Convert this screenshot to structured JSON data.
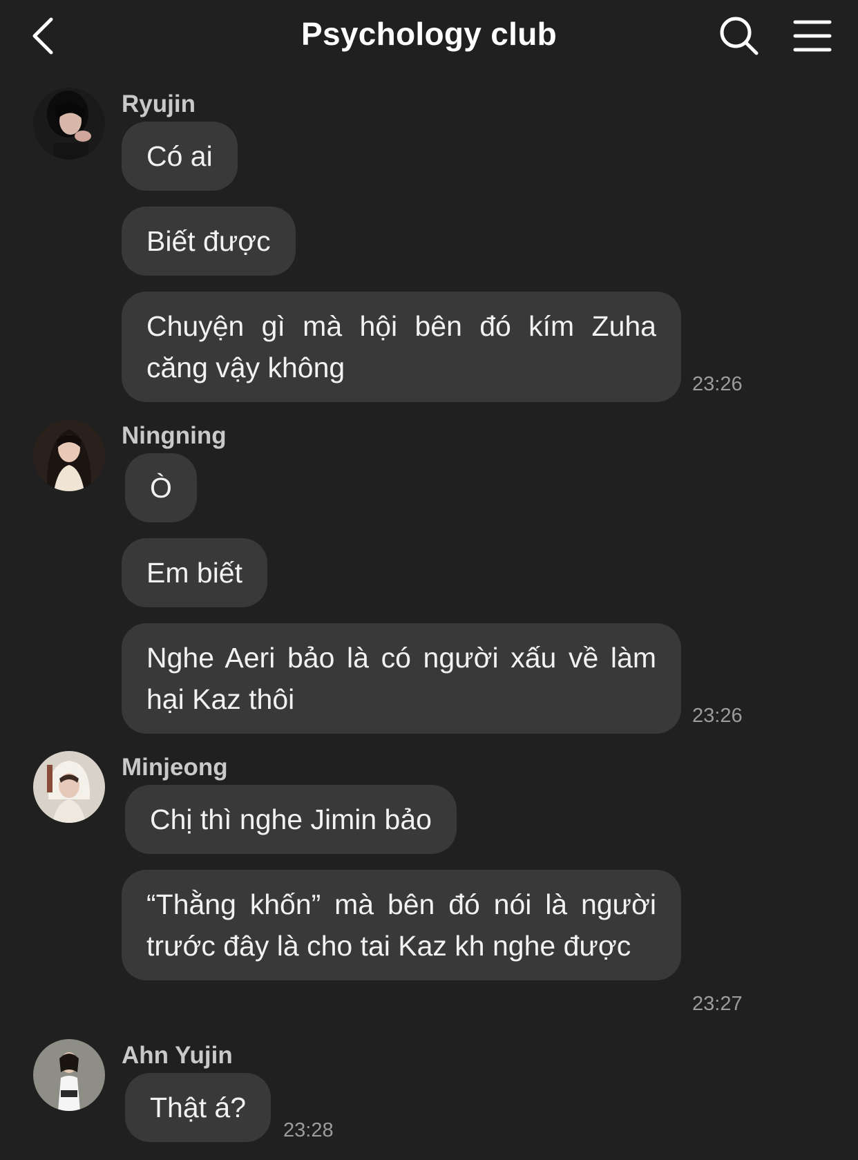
{
  "header": {
    "title": "Psychology club",
    "back_icon": "chevron-left-icon",
    "search_icon": "search-icon",
    "menu_icon": "hamburger-menu-icon"
  },
  "messages": [
    {
      "sender": "Ryujin",
      "bubbles": [
        "Có ai",
        "Biết được",
        "Chuyện gì mà hội bên đó kím Zuha căng vậy không"
      ],
      "time": "23:26"
    },
    {
      "sender": "Ningning",
      "bubbles": [
        "Ò",
        "Em biết",
        "Nghe Aeri bảo là có người xấu về làm hại Kaz thôi"
      ],
      "time": "23:26"
    },
    {
      "sender": "Minjeong",
      "bubbles": [
        "Chị thì nghe Jimin bảo",
        "“Thằng khốn” mà bên đó nói là người trước đây là cho tai Kaz kh nghe được"
      ],
      "time": "23:27"
    },
    {
      "sender": "Ahn Yujin",
      "bubbles": [
        "Thật á?"
      ],
      "time": "23:28"
    }
  ],
  "colors": {
    "background": "#202020",
    "bubble": "#393939",
    "sender_name": "#c9c9c9",
    "timestamp": "#9c9c9c"
  }
}
